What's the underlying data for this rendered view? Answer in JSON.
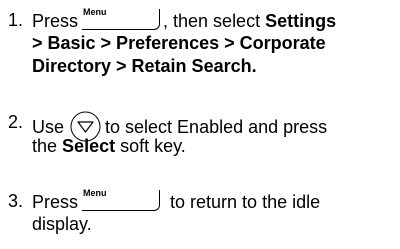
{
  "steps": [
    {
      "number": "1.",
      "press": "Press",
      "key_label": "Menu",
      "then_select": ", then select",
      "path_line1": "Settings",
      "path_line2": "> Basic > Preferences > Corporate",
      "path_line3": "Directory > Retain Search."
    },
    {
      "number": "2.",
      "use": "Use",
      "icon": "down-arrow-nav-key-icon",
      "rest_line1": "to select Enabled and press",
      "the": "the",
      "select_word": "Select",
      "soft_key": "soft key."
    },
    {
      "number": "3.",
      "press": "Press",
      "key_label": "Menu",
      "rest_line1": "to return to the idle",
      "rest_line2": "display."
    }
  ]
}
